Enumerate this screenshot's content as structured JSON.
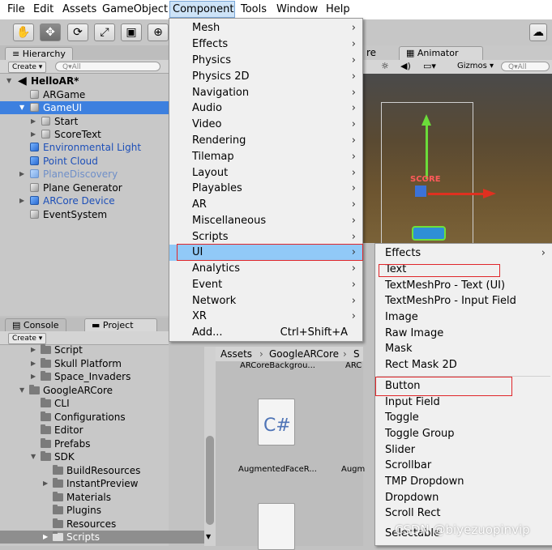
{
  "menubar": {
    "items": [
      "File",
      "Edit",
      "Assets",
      "GameObject",
      "Component",
      "Tools",
      "Window",
      "Help"
    ]
  },
  "toolbar": {
    "tools": [
      "hand-tool-icon",
      "move-tool-icon",
      "rotate-tool-icon",
      "scale-tool-icon",
      "rect-tool-icon",
      "transform-tool-icon"
    ]
  },
  "hierarchy": {
    "tab": "Hierarchy",
    "create": "Create",
    "search_placeholder": "All",
    "scene": "HelloAR*",
    "rows": [
      {
        "label": "ARGame",
        "style": "normal"
      },
      {
        "label": "GameUI",
        "style": "selected"
      },
      {
        "label": "Start",
        "style": "normal"
      },
      {
        "label": "ScoreText",
        "style": "normal"
      },
      {
        "label": "Environmental Light",
        "style": "blue"
      },
      {
        "label": "Point Cloud",
        "style": "blue"
      },
      {
        "label": "PlaneDiscovery",
        "style": "light"
      },
      {
        "label": "Plane Generator",
        "style": "normal"
      },
      {
        "label": "ARCore Device",
        "style": "blue"
      },
      {
        "label": "EventSystem",
        "style": "normal"
      }
    ]
  },
  "bottom_tabs": {
    "console": "Console",
    "project": "Project",
    "create": "Create"
  },
  "project": {
    "rows": [
      "Script",
      "Skull Platform",
      "Space_Invaders",
      "GoogleARCore",
      "CLI",
      "Configurations",
      "Editor",
      "Prefabs",
      "SDK",
      "BuildResources",
      "InstantPreview",
      "Materials",
      "Plugins",
      "Resources",
      "Scripts"
    ]
  },
  "assets": {
    "breadcrumb": [
      "Assets",
      "GoogleARCore",
      "S"
    ],
    "item1_label": "ARCoreBackgrou...",
    "item1b_label": "ARC",
    "cs_icon_text": "C#",
    "item2_label": "AugmentedFaceR...",
    "item2b_label": "Augm"
  },
  "scene_view": {
    "tab_partial": "re",
    "animator_tab": "Animator",
    "gizmos": "Gizmos",
    "search_placeholder": "All",
    "score_label": "SCORE"
  },
  "component_menu": {
    "items": [
      {
        "label": "Mesh",
        "sub": true
      },
      {
        "label": "Effects",
        "sub": true
      },
      {
        "label": "Physics",
        "sub": true
      },
      {
        "label": "Physics 2D",
        "sub": true
      },
      {
        "label": "Navigation",
        "sub": true
      },
      {
        "label": "Audio",
        "sub": true
      },
      {
        "label": "Video",
        "sub": true
      },
      {
        "label": "Rendering",
        "sub": true
      },
      {
        "label": "Tilemap",
        "sub": true
      },
      {
        "label": "Layout",
        "sub": true
      },
      {
        "label": "Playables",
        "sub": true
      },
      {
        "label": "AR",
        "sub": true
      },
      {
        "label": "Miscellaneous",
        "sub": true
      },
      {
        "label": "Scripts",
        "sub": true
      },
      {
        "label": "UI",
        "sub": true
      },
      {
        "label": "Analytics",
        "sub": true
      },
      {
        "label": "Event",
        "sub": true
      },
      {
        "label": "Network",
        "sub": true
      },
      {
        "label": "XR",
        "sub": true
      },
      {
        "label": "Add...",
        "sub": false,
        "shortcut": "Ctrl+Shift+A"
      }
    ],
    "highlighted": "UI"
  },
  "ui_submenu": {
    "items": [
      "Effects",
      "Text",
      "TextMeshPro - Text (UI)",
      "TextMeshPro - Input Field",
      "Image",
      "Raw Image",
      "Mask",
      "Rect Mask 2D",
      "Button",
      "Input Field",
      "Toggle",
      "Toggle Group",
      "Slider",
      "Scrollbar",
      "TMP Dropdown",
      "Dropdown",
      "Scroll Rect",
      "Selectable"
    ],
    "annotated": [
      "Text",
      "Button"
    ]
  },
  "watermark": "CSDN @biyezuopinvip",
  "colors": {
    "selection": "#3d80df",
    "menu_highlight": "#91c9f7",
    "annotation_red": "#e0262a"
  }
}
